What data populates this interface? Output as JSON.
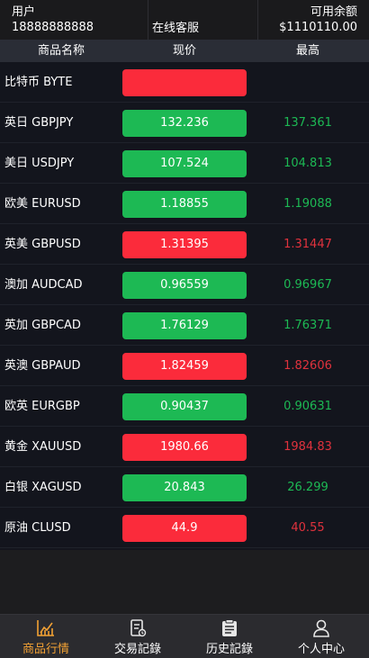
{
  "header": {
    "user_label": "用户",
    "user_value": "18888888888",
    "service_label": "在线客服",
    "balance_label": "可用余额",
    "balance_value": "$1110110.00"
  },
  "columns": {
    "name": "商品名称",
    "price": "现价",
    "high": "最高"
  },
  "rows": [
    {
      "name": "比特币 BYTE",
      "price": "",
      "high": "",
      "trend": "down"
    },
    {
      "name": "英日 GBPJPY",
      "price": "132.236",
      "high": "137.361",
      "trend": "up"
    },
    {
      "name": "美日 USDJPY",
      "price": "107.524",
      "high": "104.813",
      "trend": "up"
    },
    {
      "name": "欧美 EURUSD",
      "price": "1.18855",
      "high": "1.19088",
      "trend": "up"
    },
    {
      "name": "英美 GBPUSD",
      "price": "1.31395",
      "high": "1.31447",
      "trend": "down"
    },
    {
      "name": "澳加 AUDCAD",
      "price": "0.96559",
      "high": "0.96967",
      "trend": "up"
    },
    {
      "name": "英加 GBPCAD",
      "price": "1.76129",
      "high": "1.76371",
      "trend": "up"
    },
    {
      "name": "英澳 GBPAUD",
      "price": "1.82459",
      "high": "1.82606",
      "trend": "down"
    },
    {
      "name": "欧英 EURGBP",
      "price": "0.90437",
      "high": "0.90631",
      "trend": "up"
    },
    {
      "name": "黄金 XAUUSD",
      "price": "1980.66",
      "high": "1984.83",
      "trend": "down"
    },
    {
      "name": "白银 XAGUSD",
      "price": "20.843",
      "high": "26.299",
      "trend": "up"
    },
    {
      "name": "原油 CLUSD",
      "price": "44.9",
      "high": "40.55",
      "trend": "down"
    }
  ],
  "nav": [
    {
      "label": "商品行情",
      "icon": "chart-icon",
      "active": true
    },
    {
      "label": "交易記錄",
      "icon": "trade-record-icon",
      "active": false
    },
    {
      "label": "历史記錄",
      "icon": "history-clipboard-icon",
      "active": false
    },
    {
      "label": "个人中心",
      "icon": "user-icon",
      "active": false
    }
  ],
  "colors": {
    "up": "#1db954",
    "down": "#fb2b3b",
    "accent": "#f2a134"
  }
}
